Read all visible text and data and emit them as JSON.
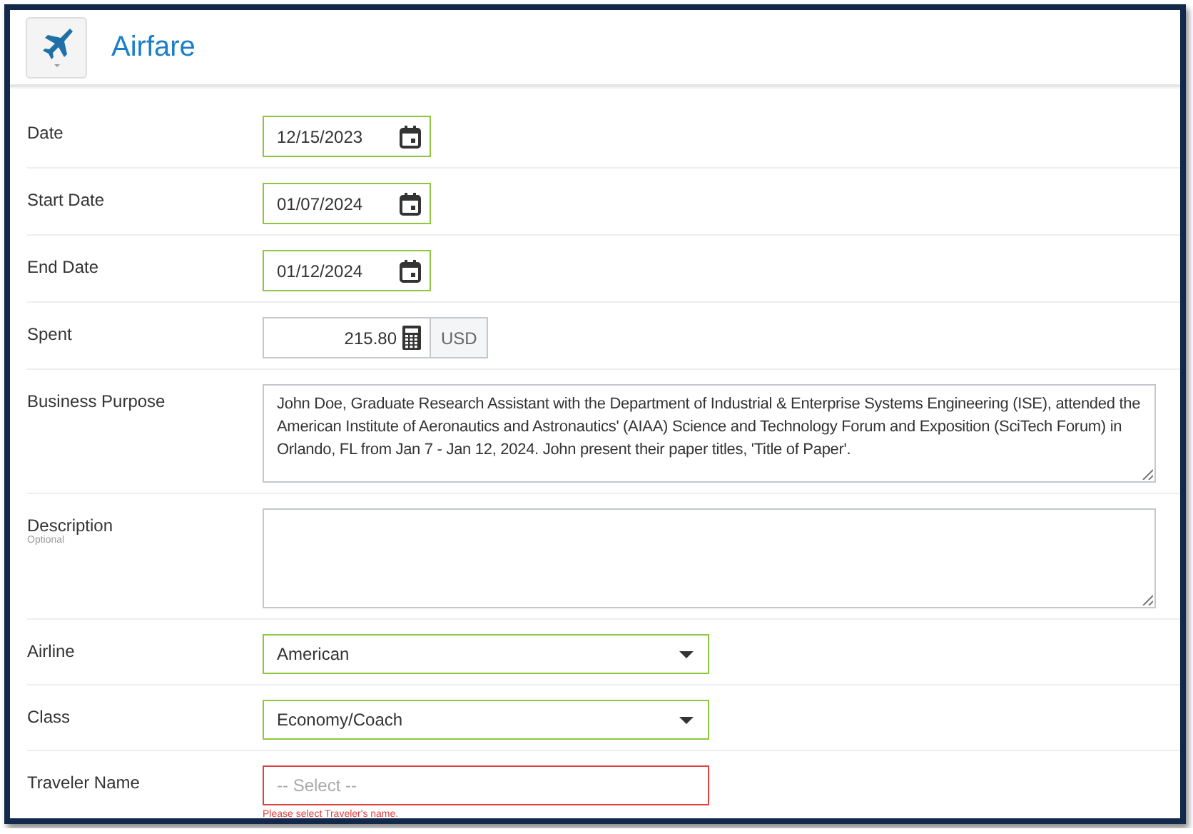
{
  "header": {
    "title": "Airfare"
  },
  "fields": [
    {
      "kind": "date",
      "label": "Date",
      "value": "12/15/2023",
      "valid": true,
      "invalid": false
    },
    {
      "kind": "date",
      "label": "Start Date",
      "value": "01/07/2024",
      "valid": true,
      "invalid": false
    },
    {
      "kind": "date",
      "label": "End Date",
      "value": "01/12/2024",
      "valid": true,
      "invalid": false
    },
    {
      "kind": "amount",
      "label": "Spent",
      "value": "215.80",
      "currency": "USD",
      "valid": false,
      "invalid": false
    },
    {
      "kind": "textarea",
      "label": "Business Purpose",
      "value": "John Doe, Graduate Research Assistant with the Department of Industrial & Enterprise Systems Engineering (ISE), attended the American Institute of Aeronautics and Astronautics' (AIAA) Science and Technology Forum and Exposition (SciTech Forum) in Orlando, FL from Jan 7 - Jan 12, 2024. John present their paper titles, 'Title of Paper'.",
      "valid": false,
      "invalid": false
    },
    {
      "kind": "textarea",
      "label": "Description",
      "hint": "Optional",
      "valid": false,
      "invalid": false
    },
    {
      "kind": "select",
      "label": "Airline",
      "value": "American",
      "valid": true,
      "invalid": false
    },
    {
      "kind": "select",
      "label": "Class",
      "value": "Economy/Coach",
      "valid": true,
      "invalid": false
    },
    {
      "kind": "select",
      "label": "Traveler Name",
      "placeholder": "-- Select --",
      "valid": false,
      "invalid": true,
      "error": "Please select Traveler's name."
    }
  ]
}
